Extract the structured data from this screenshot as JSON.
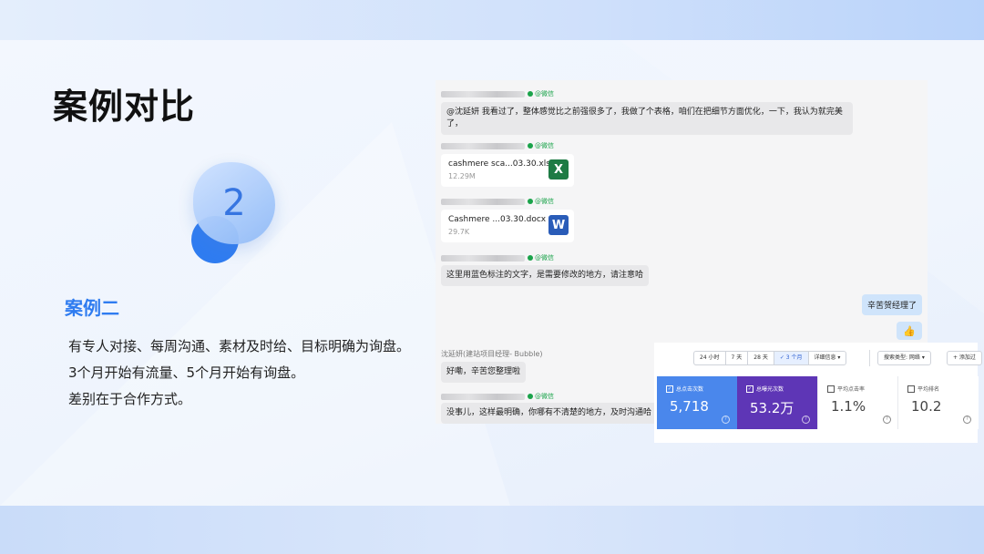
{
  "slide": {
    "title": "案例对比",
    "number": "2",
    "case_title": "案例二",
    "lines": [
      "有专人对接、每周沟通、素材及时给、目标明确为询盘。",
      "3个月开始有流量、5个月开始有询盘。",
      "差别在于合作方式。"
    ]
  },
  "chat": {
    "sender_tag": "@微信",
    "messages": [
      {
        "type": "text",
        "text": "@沈延妍 我看过了，整体感觉比之前强很多了，我做了个表格，咱们在把细节方面优化，一下，我认为就完美了，"
      },
      {
        "type": "file",
        "name": "cashmere sca...03.30.xls",
        "size": "12.29M",
        "icon_label": "X",
        "icon": "excel-icon"
      },
      {
        "type": "file",
        "name": "Cashmere ...03.30.docx",
        "size": "29.7K",
        "icon_label": "W",
        "icon": "word-icon"
      },
      {
        "type": "text",
        "text": "这里用蓝色标注的文字，是需要修改的地方，请注意哈"
      },
      {
        "type": "self",
        "text": "辛苦贺经理了"
      },
      {
        "type": "self_emoji",
        "text": "👍"
      },
      {
        "type": "named",
        "name": "沈延妍(建站项目经理- Bubble)",
        "text": "好嘞，辛苦您整理啦"
      },
      {
        "type": "text",
        "text": "没事儿，这样最明确，你哪有不清楚的地方，及时沟通哈"
      }
    ]
  },
  "analytics": {
    "ranges": [
      "24 小时",
      "7 天",
      "28 天",
      "✓ 3 个月",
      "详细信息 ▾"
    ],
    "search_type": "搜索类型: 网络 ▾",
    "add_filter": "+ 添加过",
    "cards": [
      {
        "label": "总点击次数",
        "value": "5,718",
        "style": "blue",
        "checked": true
      },
      {
        "label": "总曝光次数",
        "value": "53.2万",
        "style": "purple",
        "checked": true
      },
      {
        "label": "平均点击率",
        "value": "1.1%",
        "style": "plain",
        "checked": false
      },
      {
        "label": "平均排名",
        "value": "10.2",
        "style": "plain",
        "checked": false
      }
    ]
  },
  "colors": {
    "accent": "#2f7cf0",
    "card_blue": "#4a87ec",
    "card_purple": "#5e36b6"
  }
}
